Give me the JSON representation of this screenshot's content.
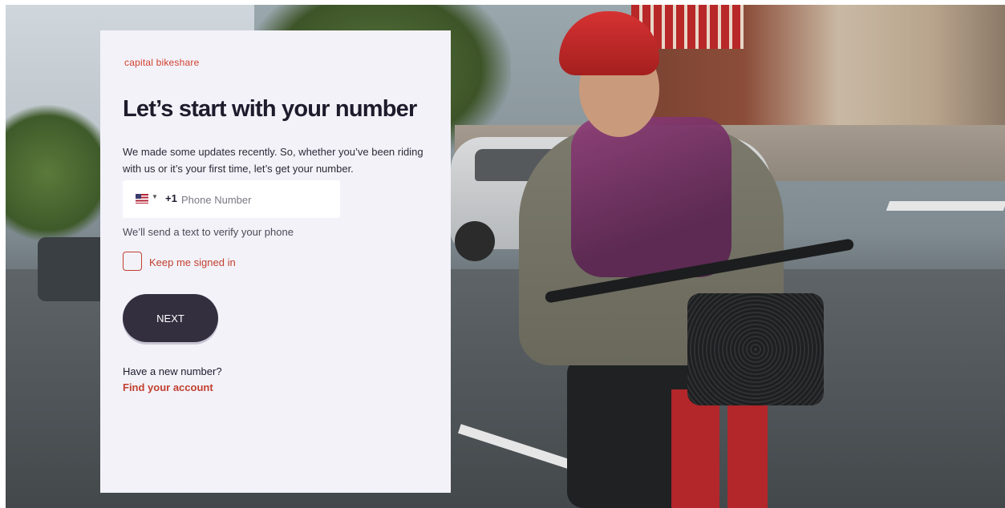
{
  "brand": {
    "logo_text": "capital bikeshare",
    "accent_color": "#c2402f"
  },
  "login": {
    "title": "Let’s start with your number",
    "description": "We made some updates recently. So, whether you’ve been riding with us or it’s your first time, let’s get your number.",
    "phone": {
      "country_flag": "us-flag-icon",
      "dial_code": "+1",
      "value": "",
      "placeholder": "Phone Number"
    },
    "hint": "We’ll send a text to verify your phone",
    "keep_signed_in": {
      "label": "Keep me signed in",
      "checked": false
    },
    "next_label": "NEXT",
    "new_number_prompt": "Have a new number?",
    "find_account_label": "Find your account"
  }
}
